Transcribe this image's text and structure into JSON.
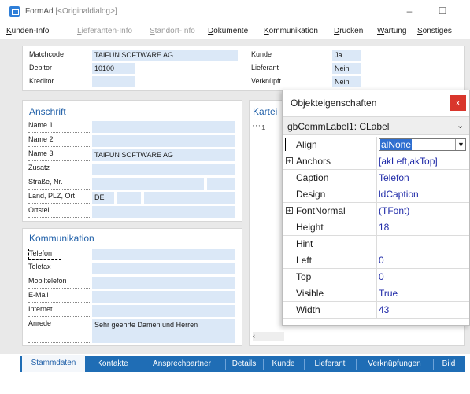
{
  "window": {
    "title": "FormAd",
    "subtitle": "[<Originaldialog>]",
    "minimize": "–",
    "maximize": "☐"
  },
  "menu": [
    {
      "label": "Kunden-Info",
      "enabled": true
    },
    {
      "label": "Lieferanten-Info",
      "enabled": false
    },
    {
      "label": "Standort-Info",
      "enabled": false
    },
    {
      "label": "Dokumente",
      "enabled": true
    },
    {
      "label": "Kommunikation",
      "enabled": true
    },
    {
      "label": "Drucken",
      "enabled": true
    },
    {
      "label": "Wartung",
      "enabled": true
    },
    {
      "label": "Sonstiges",
      "enabled": true
    }
  ],
  "header_fields": {
    "left": [
      {
        "label": "Matchcode",
        "value": "TAIFUN SOFTWARE AG"
      },
      {
        "label": "Debitor",
        "value": "10100"
      },
      {
        "label": "Kreditor",
        "value": ""
      }
    ],
    "right": [
      {
        "label": "Kunde",
        "value": "Ja"
      },
      {
        "label": "Lieferant",
        "value": "Nein"
      },
      {
        "label": "Verknüpft",
        "value": "Nein"
      }
    ]
  },
  "anschrift": {
    "title": "Anschrift",
    "rows": [
      {
        "label": "Name 1",
        "value": ""
      },
      {
        "label": "Name 2",
        "value": ""
      },
      {
        "label": "Name 3",
        "value": "TAIFUN SOFTWARE AG"
      },
      {
        "label": "Zusatz",
        "value": ""
      },
      {
        "label": "Straße, Nr.",
        "value": ""
      },
      {
        "label": "Land, PLZ, Ort",
        "value": "DE"
      },
      {
        "label": "Ortsteil",
        "value": ""
      }
    ]
  },
  "kommunikation": {
    "title": "Kommunikation",
    "rows": [
      {
        "label": "Telefon",
        "value": ""
      },
      {
        "label": "Telefax",
        "value": ""
      },
      {
        "label": "Mobiltelefon",
        "value": ""
      },
      {
        "label": "E-Mail",
        "value": ""
      },
      {
        "label": "Internet",
        "value": ""
      },
      {
        "label": "Anrede",
        "value": "Sehr geehrte Damen und Herren"
      }
    ]
  },
  "kartei": {
    "title": "Kartei",
    "tick": "' ' ' 1"
  },
  "tabs": [
    {
      "label": "Stammdaten",
      "active": true
    },
    {
      "label": "Kontakte"
    },
    {
      "label": "Ansprechpartner"
    },
    {
      "label": "Details"
    },
    {
      "label": "Kunde"
    },
    {
      "label": "Lieferant"
    },
    {
      "label": "Verknüpfungen"
    },
    {
      "label": "Bild"
    }
  ],
  "inspector": {
    "title": "Objekteigenschaften",
    "close": "x",
    "component": "gbCommLabel1: CLabel",
    "properties": [
      {
        "name": "Align",
        "value": "alNone",
        "expandable": false,
        "selected": true
      },
      {
        "name": "Anchors",
        "value": "[akLeft,akTop]",
        "expandable": true
      },
      {
        "name": "Caption",
        "value": "Telefon",
        "expandable": false
      },
      {
        "name": "Design",
        "value": "ldCaption",
        "expandable": false
      },
      {
        "name": "FontNormal",
        "value": "(TFont)",
        "expandable": true
      },
      {
        "name": "Height",
        "value": "18",
        "expandable": false
      },
      {
        "name": "Hint",
        "value": "",
        "expandable": false
      },
      {
        "name": "Left",
        "value": "0",
        "expandable": false
      },
      {
        "name": "Top",
        "value": "0",
        "expandable": false
      },
      {
        "name": "Visible",
        "value": "True",
        "expandable": false
      },
      {
        "name": "Width",
        "value": "43",
        "expandable": false
      }
    ]
  }
}
